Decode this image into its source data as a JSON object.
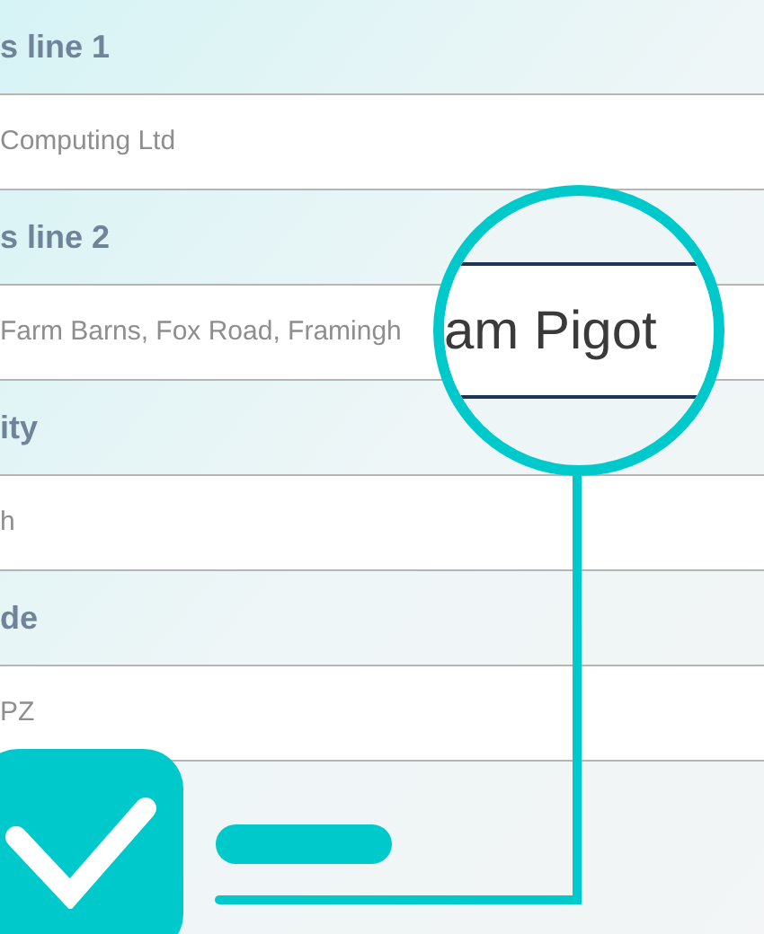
{
  "fields": [
    {
      "label": "s line 1",
      "value": "Computing Ltd"
    },
    {
      "label": "s line 2",
      "value": "Farm Barns, Fox Road, Framingh"
    },
    {
      "label": "ity",
      "value": "h"
    },
    {
      "label": "de",
      "value": "PZ"
    }
  ],
  "magnifier": {
    "value": "am Pigot"
  },
  "checkbox": {
    "checked": true
  }
}
